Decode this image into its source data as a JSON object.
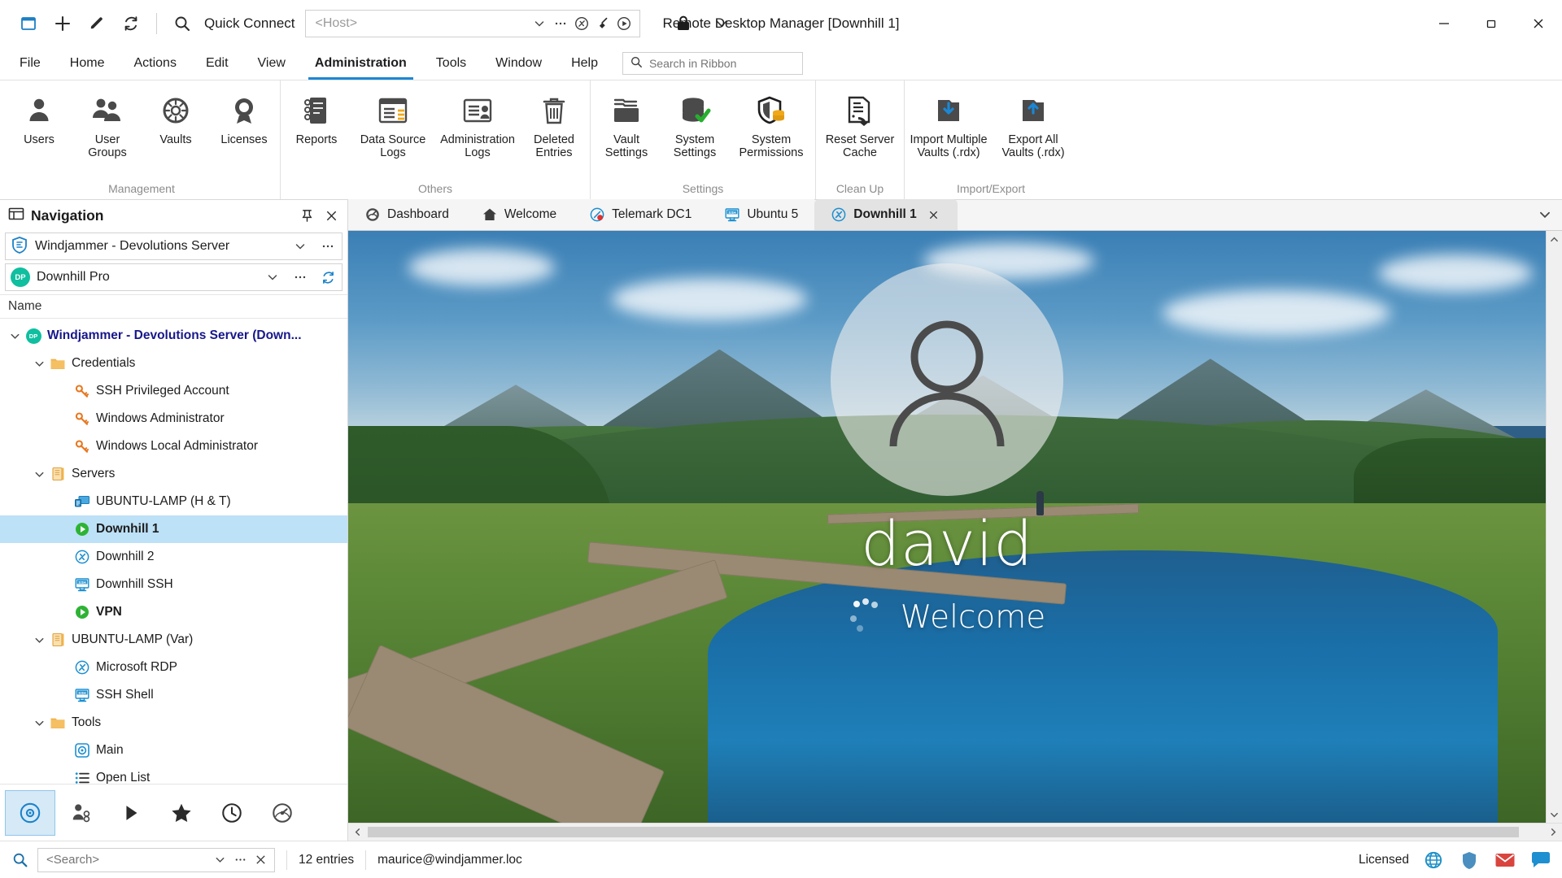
{
  "window": {
    "title": "Remote Desktop Manager [Downhill 1]",
    "minimize": "minimize-button",
    "restore": "restore-button",
    "close": "close-button"
  },
  "quick_access": {
    "new_entry_icon": "new-entry-icon",
    "add_icon": "plus-icon",
    "edit_icon": "pencil-icon",
    "refresh_icon": "refresh-icon",
    "search_icon": "search-icon",
    "label": "Quick Connect",
    "host_placeholder": "<Host>",
    "host_value": "",
    "dropdown_icon": "chevron-down-icon",
    "more_icon": "ellipsis-icon",
    "vpn_icon": "vpn-icon",
    "broom_icon": "broom-icon",
    "play_icon": "play-icon",
    "lock_icon": "lock-icon",
    "expand_icon": "chevron-down-icon"
  },
  "ribbon": {
    "tabs": [
      {
        "label": "File",
        "active": false
      },
      {
        "label": "Home",
        "active": false
      },
      {
        "label": "Actions",
        "active": false
      },
      {
        "label": "Edit",
        "active": false
      },
      {
        "label": "View",
        "active": false
      },
      {
        "label": "Administration",
        "active": true
      },
      {
        "label": "Tools",
        "active": false
      },
      {
        "label": "Window",
        "active": false
      },
      {
        "label": "Help",
        "active": false
      }
    ],
    "search_placeholder": "Search in Ribbon",
    "search_value": "",
    "groups": [
      {
        "label": "Management",
        "items": [
          {
            "label": "Users",
            "icon": "user-icon"
          },
          {
            "label": "User Groups",
            "icon": "user-groups-icon"
          },
          {
            "label": "Vaults",
            "icon": "vault-icon"
          },
          {
            "label": "Licenses",
            "icon": "license-badge-icon"
          }
        ]
      },
      {
        "label": "Others",
        "items": [
          {
            "label": "Reports",
            "icon": "reports-book-icon"
          },
          {
            "label": "Data Source\nLogs",
            "icon": "data-source-logs-icon"
          },
          {
            "label": "Administration\nLogs",
            "icon": "administration-logs-icon"
          },
          {
            "label": "Deleted\nEntries",
            "icon": "trash-icon"
          }
        ]
      },
      {
        "label": "Settings",
        "items": [
          {
            "label": "Vault\nSettings",
            "icon": "folder-settings-icon"
          },
          {
            "label": "System\nSettings",
            "icon": "system-settings-icon"
          },
          {
            "label": "System\nPermissions",
            "icon": "system-permissions-icon"
          }
        ]
      },
      {
        "label": "Clean Up",
        "items": [
          {
            "label": "Reset Server\nCache",
            "icon": "reset-server-cache-icon"
          }
        ]
      },
      {
        "label": "Import/Export",
        "items": [
          {
            "label": "Import Multiple\nVaults (.rdx)",
            "icon": "import-icon"
          },
          {
            "label": "Export All\nVaults (.rdx)",
            "icon": "export-icon"
          }
        ]
      }
    ]
  },
  "navigation": {
    "panel_icon": "panel-icon",
    "title": "Navigation",
    "pin_icon": "pin-icon",
    "close_icon": "close-icon",
    "data_source": {
      "icon": "devolutions-shield-icon",
      "value": "Windjammer - Devolutions Server",
      "dropdown_icon": "chevron-down-icon",
      "more_icon": "ellipsis-icon"
    },
    "vault": {
      "icon": "vault-avatar-dp",
      "avatar_text": "DP",
      "value": "Downhill Pro",
      "dropdown_icon": "chevron-down-icon",
      "more_icon": "ellipsis-icon",
      "refresh_icon": "refresh-icon"
    },
    "column_header": "Name",
    "tree": [
      {
        "label": "Windjammer - Devolutions Server (Down...",
        "indent": 0,
        "icon": "vault-avatar-dp",
        "avatar_text": "DP",
        "twisty": "expanded",
        "style": "root",
        "selected": false
      },
      {
        "label": "Credentials",
        "indent": 1,
        "icon": "folder-icon",
        "twisty": "expanded",
        "style": "normal",
        "selected": false
      },
      {
        "label": "SSH Privileged Account",
        "indent": 2,
        "icon": "key-icon",
        "twisty": "none",
        "style": "normal",
        "selected": false
      },
      {
        "label": "Windows Administrator",
        "indent": 2,
        "icon": "key-icon",
        "twisty": "none",
        "style": "normal",
        "selected": false
      },
      {
        "label": "Windows Local Administrator",
        "indent": 2,
        "icon": "key-icon",
        "twisty": "none",
        "style": "normal",
        "selected": false
      },
      {
        "label": "Servers",
        "indent": 1,
        "icon": "server-folder-icon",
        "twisty": "expanded",
        "style": "normal",
        "selected": false
      },
      {
        "label": "UBUNTU-LAMP (H & T)",
        "indent": 2,
        "icon": "host-terminal-icon",
        "twisty": "none",
        "style": "normal",
        "selected": false
      },
      {
        "label": "Downhill 1",
        "indent": 2,
        "icon": "green-play-icon",
        "twisty": "none",
        "style": "bold",
        "selected": true
      },
      {
        "label": "Downhill 2",
        "indent": 2,
        "icon": "rdp-icon",
        "twisty": "none",
        "style": "normal",
        "selected": false
      },
      {
        "label": "Downhill SSH",
        "indent": 2,
        "icon": "ssh-icon",
        "twisty": "none",
        "style": "normal",
        "selected": false
      },
      {
        "label": "VPN",
        "indent": 2,
        "icon": "green-play-icon",
        "twisty": "none",
        "style": "bold",
        "selected": false
      },
      {
        "label": "UBUNTU-LAMP (Var)",
        "indent": 1,
        "icon": "server-folder-icon",
        "twisty": "expanded",
        "style": "normal",
        "selected": false
      },
      {
        "label": "Microsoft RDP",
        "indent": 2,
        "icon": "rdp-icon",
        "twisty": "none",
        "style": "normal",
        "selected": false
      },
      {
        "label": "SSH Shell",
        "indent": 2,
        "icon": "ssh-icon",
        "twisty": "none",
        "style": "normal",
        "selected": false
      },
      {
        "label": "Tools",
        "indent": 1,
        "icon": "folder-icon",
        "twisty": "expanded",
        "style": "normal",
        "selected": false
      },
      {
        "label": "Main",
        "indent": 2,
        "icon": "tool-main-icon",
        "twisty": "none",
        "style": "normal",
        "selected": false
      },
      {
        "label": "Open List",
        "indent": 2,
        "icon": "list-icon",
        "twisty": "none",
        "style": "normal",
        "selected": false
      }
    ],
    "toolbar": [
      {
        "icon": "navigation-view-icon",
        "active": true
      },
      {
        "icon": "vault-users-icon",
        "active": false
      },
      {
        "icon": "play-icon",
        "active": false
      },
      {
        "icon": "favorites-star-icon",
        "active": false
      },
      {
        "icon": "recent-history-icon",
        "active": false
      },
      {
        "icon": "dashboard-gauge-icon",
        "active": false
      }
    ]
  },
  "session_tabs": [
    {
      "label": "Dashboard",
      "icon": "dashboard-icon",
      "active": false,
      "closable": false
    },
    {
      "label": "Welcome",
      "icon": "home-icon",
      "active": false,
      "closable": false
    },
    {
      "label": "Telemark DC1",
      "icon": "rdp-recording-icon",
      "active": false,
      "closable": false
    },
    {
      "label": "Ubuntu 5",
      "icon": "ssh-icon",
      "active": false,
      "closable": false
    },
    {
      "label": "Downhill 1",
      "icon": "rdp-icon",
      "active": true,
      "closable": true
    }
  ],
  "tabbar_overflow_icon": "chevron-down-icon",
  "session_view": {
    "avatar_icon": "user-avatar-icon",
    "username": "david",
    "status": "Welcome",
    "spinner": "loading-dots"
  },
  "scrollbars": {
    "v_up_icon": "chevron-up-icon",
    "v_down_icon": "chevron-down-icon",
    "h_left_icon": "chevron-left-icon",
    "h_right_icon": "chevron-right-icon"
  },
  "statusbar": {
    "search_icon": "search-icon",
    "search_placeholder": "<Search>",
    "search_value": "",
    "dropdown_icon": "chevron-down-icon",
    "more_icon": "ellipsis-icon",
    "clear_icon": "close-icon",
    "entries": "12 entries",
    "user": "maurice@windjammer.loc",
    "license": "Licensed",
    "icons": [
      {
        "name": "globe-icon",
        "color": "#1e90c8"
      },
      {
        "name": "shield-icon",
        "color": "#4a8fbf"
      },
      {
        "name": "mail-icon",
        "color": "#d9443f"
      },
      {
        "name": "chat-icon",
        "color": "#1e8fd0"
      }
    ]
  },
  "colors": {
    "accent": "#1c87d4",
    "selection": "#bde1f7",
    "root_text": "#17178a",
    "folder": "#f0b24a",
    "key": "#e8771f",
    "green": "#2eb335",
    "teal": "#0fbf9f"
  }
}
